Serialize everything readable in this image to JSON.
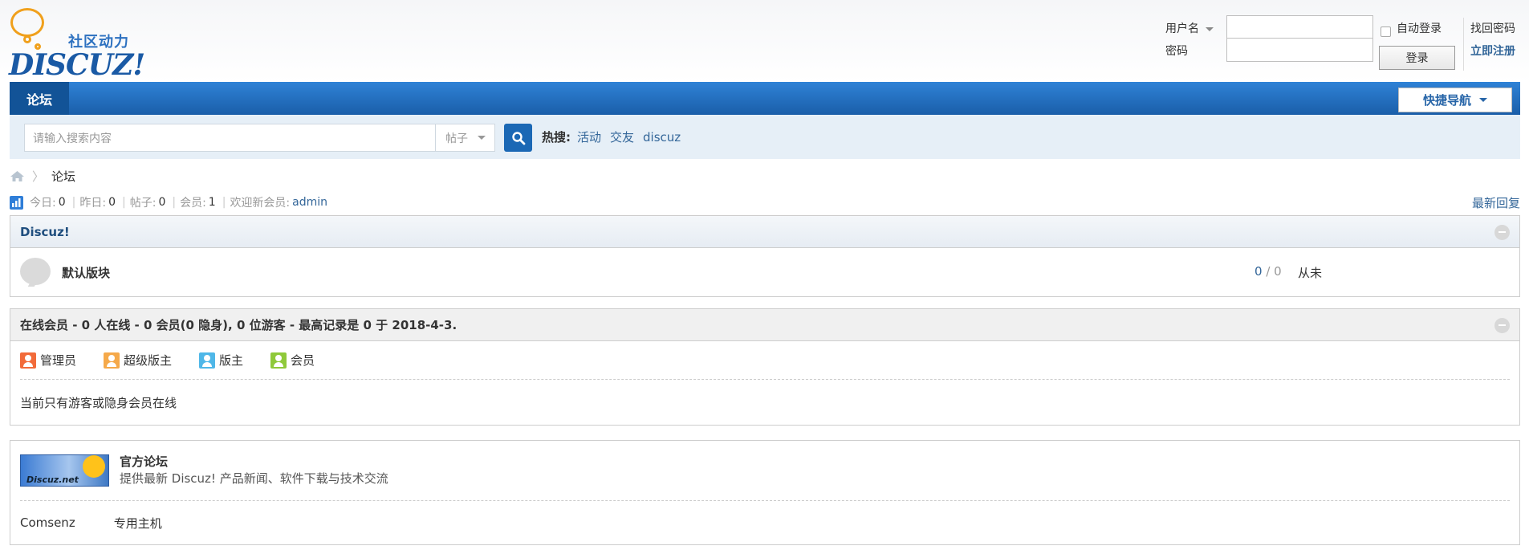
{
  "header": {
    "logo_slogan": "社区动力",
    "logo_brand": "DISCUZ!",
    "login": {
      "username_label": "用户名",
      "password_label": "密码",
      "auto_login_label": "自动登录",
      "login_button": "登录",
      "find_password": "找回密码",
      "register": "立即注册"
    }
  },
  "nav": {
    "tab_forum": "论坛",
    "quick_nav": "快捷导航"
  },
  "search": {
    "placeholder": "请输入搜索内容",
    "type": "帖子",
    "hot_label": "热搜:",
    "hot_terms": [
      "活动",
      "交友",
      "discuz"
    ]
  },
  "breadcrumb": {
    "current": "论坛"
  },
  "stats": {
    "today_label": "今日:",
    "today": "0",
    "yesterday_label": "昨日:",
    "yesterday": "0",
    "posts_label": "帖子:",
    "posts": "0",
    "members_label": "会员:",
    "members": "1",
    "newest_label": "欢迎新会员:",
    "newest_member": "admin",
    "latest_reply": "最新回复"
  },
  "category": {
    "title": "Discuz!",
    "forums": [
      {
        "name": "默认版块",
        "threads": "0",
        "sep": "/",
        "posts": "0",
        "last": "从未"
      }
    ]
  },
  "online": {
    "title": "在线会员 - 0 人在线 - 0 会员(0 隐身), 0 位游客 - 最高记录是 0 于 2018-4-3.",
    "legend": [
      {
        "label": "管理员",
        "color": "#f26b3a"
      },
      {
        "label": "超级版主",
        "color": "#f5a94a"
      },
      {
        "label": "版主",
        "color": "#4fb7e8"
      },
      {
        "label": "会员",
        "color": "#8fc93a"
      }
    ],
    "message": "当前只有游客或隐身会员在线"
  },
  "links": {
    "banner_text": "Discuz.net",
    "featured_name": "官方论坛",
    "featured_desc": "提供最新 Discuz! 产品新闻、软件下载与技术交流",
    "text_links": [
      "Comsenz",
      "专用主机"
    ]
  },
  "colors": {
    "nav_blue": "#1a5ea9",
    "link_blue": "#336699",
    "search_bg": "#e6eff7"
  }
}
